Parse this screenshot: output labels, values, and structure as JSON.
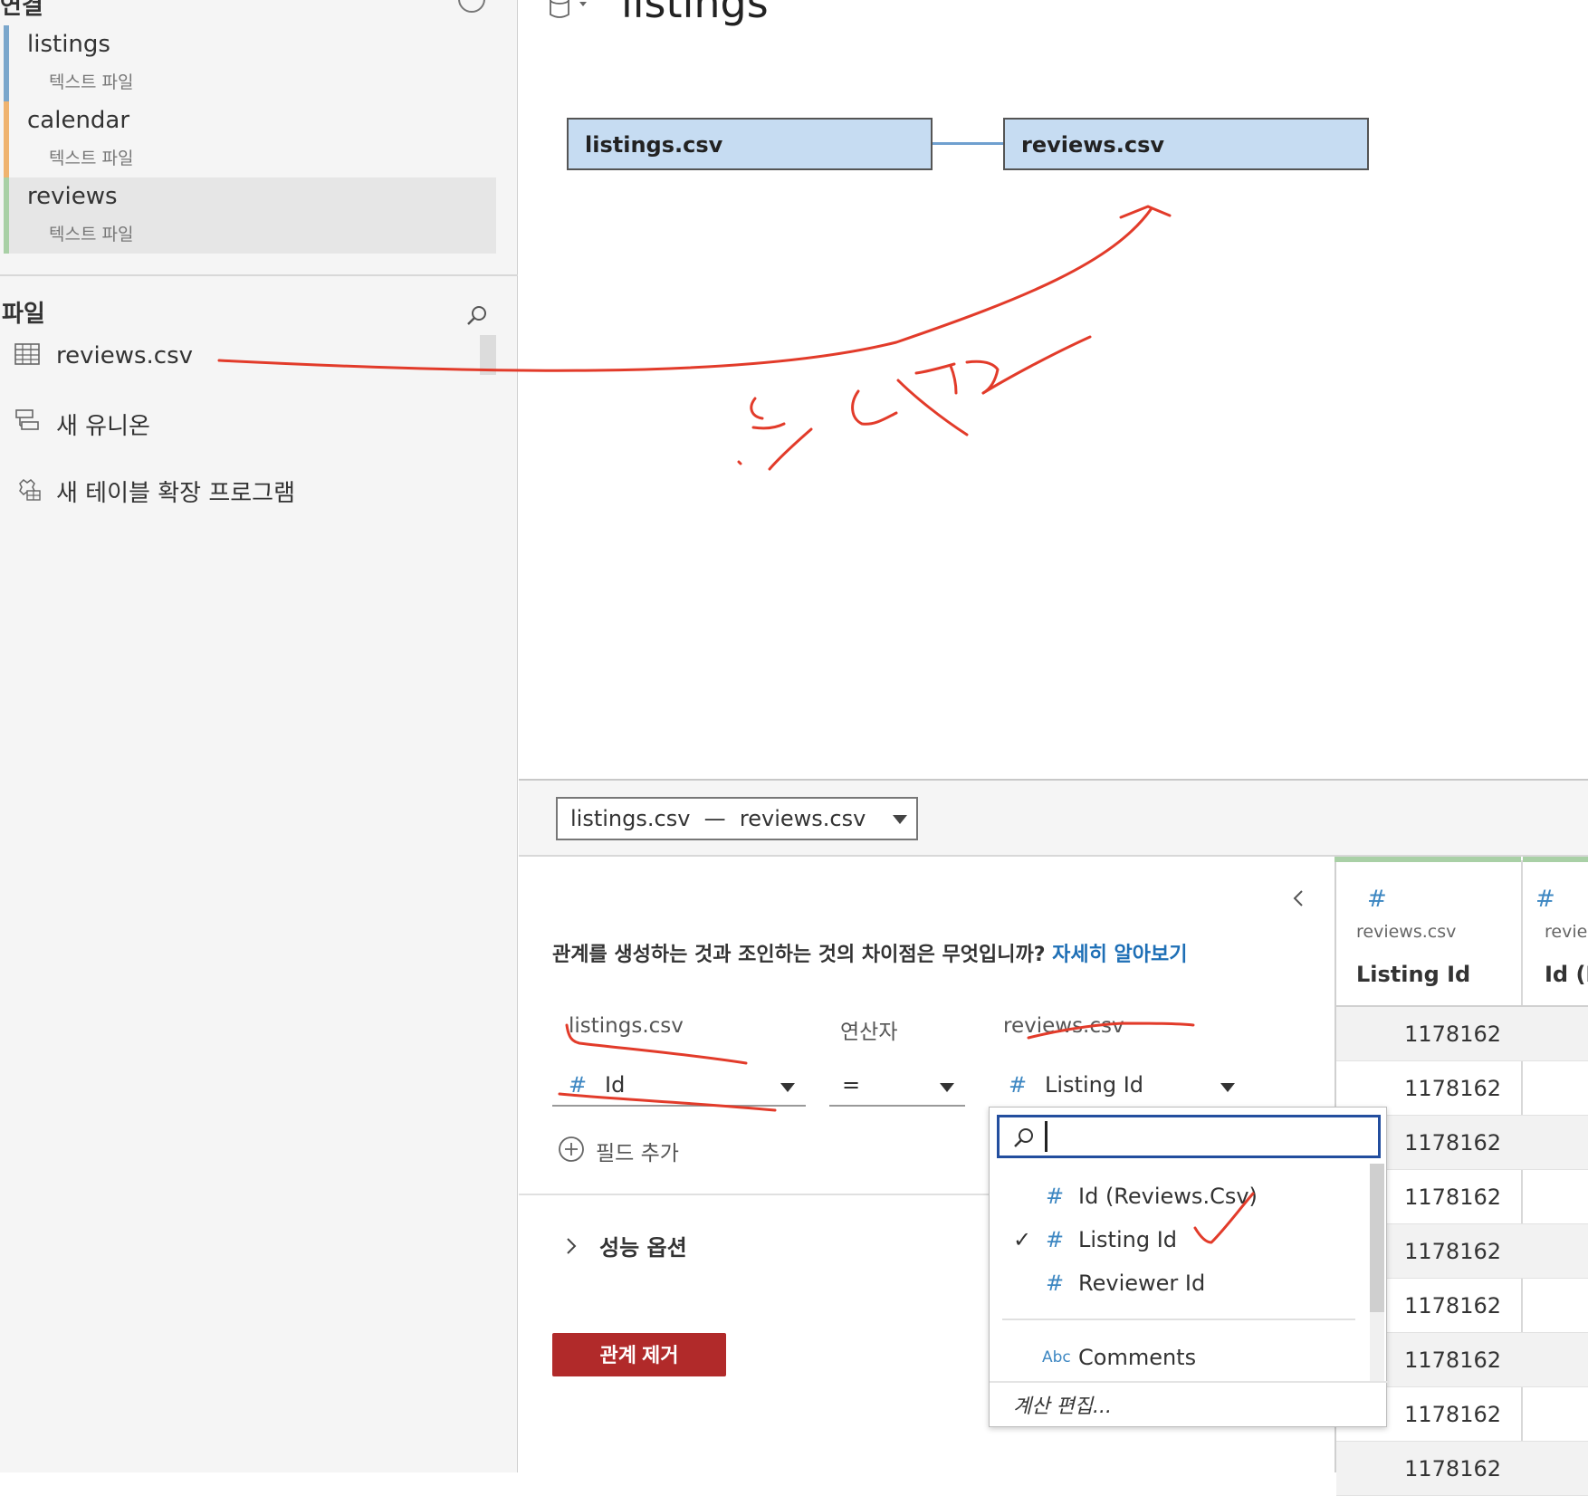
{
  "sidebar": {
    "connections_header_fragment": "연결",
    "connections": [
      {
        "name": "listings",
        "type": "텍스트 파일",
        "color": "#7ba7cc"
      },
      {
        "name": "calendar",
        "type": "텍스트 파일",
        "color": "#efb36f"
      },
      {
        "name": "reviews",
        "type": "텍스트 파일",
        "color": "#a9d0a6",
        "selected": true
      }
    ],
    "files_title": "파일",
    "files": [
      {
        "label": "reviews.csv",
        "icon": "table-grid-icon"
      },
      {
        "label": "새 유니온",
        "icon": "union-icon"
      },
      {
        "label": "새 테이블 확장 프로그램",
        "icon": "table-extension-icon"
      }
    ]
  },
  "canvas": {
    "title": "listings",
    "tables": [
      {
        "label": "listings.csv"
      },
      {
        "label": "reviews.csv"
      }
    ],
    "table_color": "#c6dcf2",
    "link_color": "#6fa0cf"
  },
  "relationship": {
    "selector_label": "listings.csv  —  reviews.csv",
    "help_question": "관계를 생성하는 것과 조인하는 것의 차이점은 무엇입니까?",
    "help_link": "자세히 알아보기",
    "left_table": "listings.csv",
    "operator_header": "연산자",
    "right_table": "reviews.csv",
    "left_field": "Id",
    "operator": "=",
    "right_field": "Listing Id",
    "add_field": "필드 추가",
    "performance_options": "성능 옵션",
    "remove_button": "관계 제거",
    "remove_color": "#b12a2a"
  },
  "dropdown": {
    "search_value": "",
    "items": [
      {
        "label": "Id (Reviews.Csv)",
        "type": "number",
        "checked": false
      },
      {
        "label": "Listing Id",
        "type": "number",
        "checked": true
      },
      {
        "label": "Reviewer Id",
        "type": "number",
        "checked": false
      },
      {
        "label": "Comments",
        "type": "string",
        "checked": false
      }
    ],
    "type_string_glyph": "Abc",
    "edit_calc": "계산 편집..."
  },
  "grid": {
    "columns": [
      {
        "source": "reviews.csv",
        "name": "Listing Id"
      },
      {
        "source": "revie",
        "name": "Id (R"
      }
    ],
    "rows": [
      "1178162",
      "1178162",
      "1178162",
      "1178162",
      "1178162",
      "1178162",
      "1178162",
      "1178162",
      "1178162"
    ]
  },
  "annotation": {
    "color": "#e23b2a",
    "text": "드래그"
  }
}
